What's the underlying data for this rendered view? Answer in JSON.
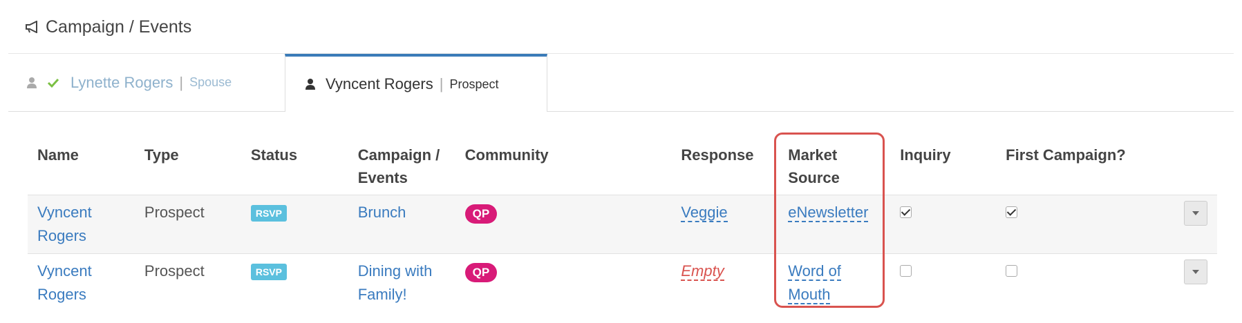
{
  "header": {
    "title": "Campaign / Events",
    "icon": "bullhorn-icon"
  },
  "tabs": [
    {
      "name": "Lynette Rogers",
      "separator": "|",
      "role": "Spouse",
      "active": false
    },
    {
      "name": "Vyncent Rogers",
      "separator": "|",
      "role": "Prospect",
      "active": true
    }
  ],
  "table": {
    "headers": [
      "Name",
      "Type",
      "Status",
      "Campaign / Events",
      "Community",
      "Response",
      "Market Source",
      "Inquiry",
      "First Campaign?"
    ],
    "rows": [
      {
        "name": "Vyncent Rogers",
        "type": "Prospect",
        "status": "RSVP",
        "campaign": "Brunch",
        "community": "QP",
        "response": "Veggie",
        "market_source": "eNewsletter",
        "inquiry": true,
        "first_campaign": true
      },
      {
        "name": "Vyncent Rogers",
        "type": "Prospect",
        "status": "RSVP",
        "campaign": "Dining with Family!",
        "community": "QP",
        "response": "Empty",
        "market_source": "Word of Mouth",
        "inquiry": false,
        "first_campaign": false
      }
    ]
  },
  "colors": {
    "accent": "#3a7bbf",
    "rsvp_badge": "#5bc0de",
    "community_pill": "#d81b78",
    "highlight": "#d9534f",
    "check": "#7bc043"
  }
}
